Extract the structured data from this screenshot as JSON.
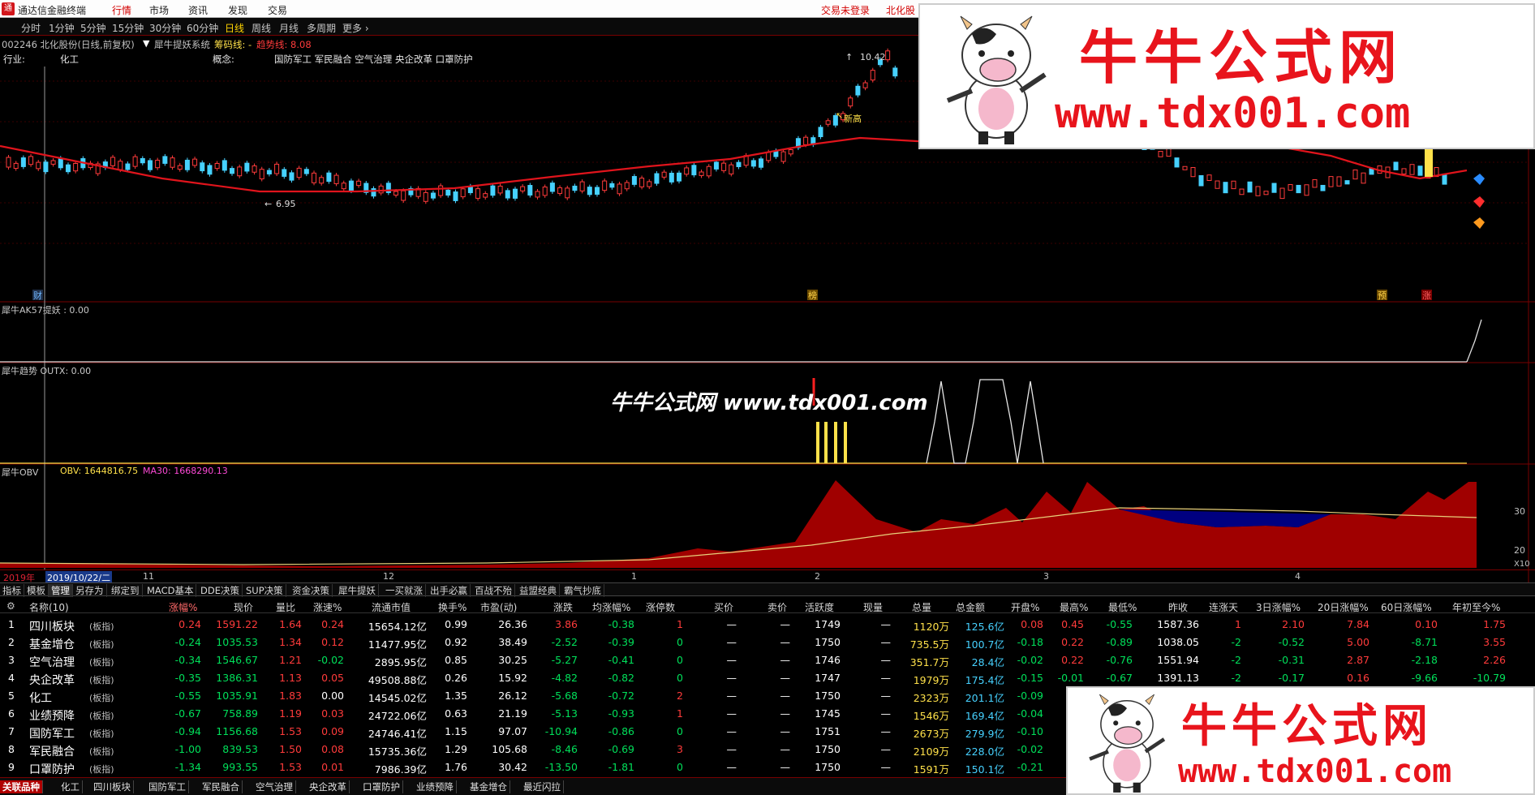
{
  "app": {
    "title": "通达信金融终端",
    "menu": [
      "行情",
      "市场",
      "资讯",
      "发现",
      "交易"
    ],
    "active_menu": "行情",
    "trade_status": "交易未登录",
    "right_label": "北化股"
  },
  "periods": [
    "分时",
    "1分钟",
    "5分钟",
    "15分钟",
    "30分钟",
    "60分钟",
    "日线",
    "周线",
    "月线",
    "多周期",
    "更多 ›"
  ],
  "selected_period": "日线",
  "stock": {
    "code_name": "002246 北化股份(日线,前复权)",
    "system": "犀牛提妖系统",
    "chip_line": "筹码线: -",
    "trend_line": "趋势线: 8.08",
    "industry_label": "行业:",
    "industry": "化工",
    "concept_label": "概念:",
    "concepts": "国防军工 军民融合 空气治理 央企改革 口罩防护",
    "high_label": "10.42",
    "low_label": "6.95",
    "new_high_label": "新高"
  },
  "price_chart_markers": {
    "cai": "财",
    "bang": "榜",
    "yu": "预",
    "zhang": "涨"
  },
  "panels": {
    "ak57": "犀牛AK57提妖 : 0.00",
    "trend": "犀牛趋势  OUTX: 0.00",
    "obv_title": "犀牛OBV",
    "obv_value": "OBV: 1644816.75",
    "ma30_value": "MA30: 1668290.13",
    "obv_axis_top": "30",
    "obv_axis_bottom": "20",
    "obv_axis_unit": "X10"
  },
  "date_axis": {
    "year": "2019年",
    "cursor_date": "2019/10/22/二",
    "months": [
      "11",
      "12",
      "1",
      "2",
      "3",
      "4"
    ]
  },
  "indicator_tabs": [
    "指标",
    "模板",
    "管理",
    "另存为",
    "绑定到",
    "MACD基本",
    "DDE决策",
    "SUP决策",
    "资金决策",
    "犀牛提妖",
    "一买就涨",
    "出手必赢",
    "百战不殆",
    "益盟经典",
    "霸气抄底"
  ],
  "table": {
    "headers": [
      "名称(10)",
      "涨幅%",
      "现价",
      "量比",
      "涨速%",
      "流通市值",
      "换手%",
      "市盈(动)",
      "涨跌",
      "均涨幅%",
      "涨停数",
      "买价",
      "卖价",
      "活跃度",
      "现量",
      "总量",
      "总金额",
      "开盘%",
      "最高%",
      "最低%",
      "昨收",
      "连涨天",
      "3日涨幅%",
      "20日涨幅%",
      "60日涨幅%",
      "年初至今%"
    ],
    "tag": "(板指)",
    "rows": [
      [
        "1",
        "四川板块",
        "0.24",
        "1591.22",
        "1.64",
        "0.24",
        "15654.12亿",
        "0.99",
        "26.36",
        "3.86",
        "-0.38",
        "1",
        "—",
        "—",
        "1749",
        "—",
        "1120万",
        "125.6亿",
        "0.08",
        "0.45",
        "-0.55",
        "1587.36",
        "1",
        "2.10",
        "7.84",
        "0.10",
        "1.75"
      ],
      [
        "2",
        "基金增仓",
        "-0.24",
        "1035.53",
        "1.34",
        "0.12",
        "11477.95亿",
        "0.92",
        "38.49",
        "-2.52",
        "-0.39",
        "0",
        "—",
        "—",
        "1750",
        "—",
        "735.5万",
        "100.7亿",
        "-0.18",
        "0.22",
        "-0.89",
        "1038.05",
        "-2",
        "-0.52",
        "5.00",
        "-8.71",
        "3.55"
      ],
      [
        "3",
        "空气治理",
        "-0.34",
        "1546.67",
        "1.21",
        "-0.02",
        "2895.95亿",
        "0.85",
        "30.25",
        "-5.27",
        "-0.41",
        "0",
        "—",
        "—",
        "1746",
        "—",
        "351.7万",
        "28.4亿",
        "-0.02",
        "0.22",
        "-0.76",
        "1551.94",
        "-2",
        "-0.31",
        "2.87",
        "-2.18",
        "2.26"
      ],
      [
        "4",
        "央企改革",
        "-0.35",
        "1386.31",
        "1.13",
        "0.05",
        "49508.88亿",
        "0.26",
        "15.92",
        "-4.82",
        "-0.82",
        "0",
        "—",
        "—",
        "1747",
        "—",
        "1979万",
        "175.4亿",
        "-0.15",
        "-0.01",
        "-0.67",
        "1391.13",
        "-2",
        "-0.17",
        "0.16",
        "-9.66",
        "-10.79"
      ],
      [
        "5",
        "化工",
        "-0.55",
        "1035.91",
        "1.83",
        "0.00",
        "14545.02亿",
        "1.35",
        "26.12",
        "-5.68",
        "-0.72",
        "2",
        "—",
        "—",
        "1750",
        "—",
        "2323万",
        "201.1亿",
        "-0.09",
        "0",
        "",
        "",
        "",
        "",
        "",
        "",
        ""
      ],
      [
        "6",
        "业绩预降",
        "-0.67",
        "758.89",
        "1.19",
        "0.03",
        "24722.06亿",
        "0.63",
        "21.19",
        "-5.13",
        "-0.93",
        "1",
        "—",
        "—",
        "1745",
        "—",
        "1546万",
        "169.4亿",
        "-0.04",
        "-0.",
        "",
        "",
        "",
        "",
        "",
        "",
        ""
      ],
      [
        "7",
        "国防军工",
        "-0.94",
        "1156.68",
        "1.53",
        "0.09",
        "24746.41亿",
        "1.15",
        "97.07",
        "-10.94",
        "-0.86",
        "0",
        "—",
        "—",
        "1751",
        "—",
        "2673万",
        "279.9亿",
        "-0.10",
        "0",
        "",
        "",
        "",
        "",
        "",
        "",
        ""
      ],
      [
        "8",
        "军民融合",
        "-1.00",
        "839.53",
        "1.50",
        "0.08",
        "15735.36亿",
        "1.29",
        "105.68",
        "-8.46",
        "-0.69",
        "3",
        "—",
        "—",
        "1750",
        "—",
        "2109万",
        "228.0亿",
        "-0.02",
        "0",
        "",
        "",
        "",
        "",
        "",
        "",
        ""
      ],
      [
        "9",
        "口罩防护",
        "-1.34",
        "993.55",
        "1.53",
        "0.01",
        "7986.39亿",
        "1.76",
        "30.42",
        "-13.50",
        "-1.81",
        "0",
        "—",
        "—",
        "1750",
        "—",
        "1591万",
        "150.1亿",
        "-0.21",
        "-0.",
        "",
        "",
        "",
        "",
        "",
        "",
        ""
      ]
    ]
  },
  "bottom_tabs": [
    "关联品种",
    "化工",
    "四川板块",
    "国防军工",
    "军民融合",
    "空气治理",
    "央企改革",
    "口罩防护",
    "业绩预降",
    "基金增仓",
    "最近闪拉"
  ],
  "watermark": {
    "title": "牛牛公式网",
    "url": "www.tdx001.com",
    "middle": "牛牛公式网 www.tdx001.com"
  },
  "colors": {
    "up": "#ff3b3b",
    "down": "#00e05a",
    "ma_line": "#e0141c",
    "obv_fill_up": "#a00000",
    "obv_fill_down": "#000080"
  }
}
